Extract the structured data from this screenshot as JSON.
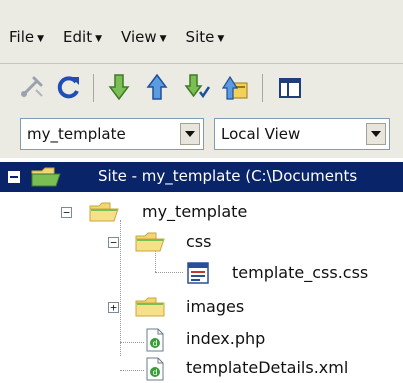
{
  "menubar": {
    "items": [
      "File",
      "Edit",
      "View",
      "Site"
    ]
  },
  "toolbar": {
    "buttons": [
      "connect-icon",
      "refresh-icon",
      "get-icon",
      "put-icon",
      "check-out-icon",
      "check-in-icon",
      "expand-icon"
    ]
  },
  "selectors": {
    "site": "my_template",
    "view": "Local View"
  },
  "tree": {
    "root": "Site - my_template (C:\\Documents",
    "folder": "my_template",
    "css_folder": "css",
    "css_file": "template_css.css",
    "images_folder": "images",
    "index_file": "index.php",
    "details_file": "templateDetails.xml"
  },
  "colors": {
    "selection": "#0a246a",
    "panel": "#ecebe3",
    "folder": "#f0d676"
  }
}
